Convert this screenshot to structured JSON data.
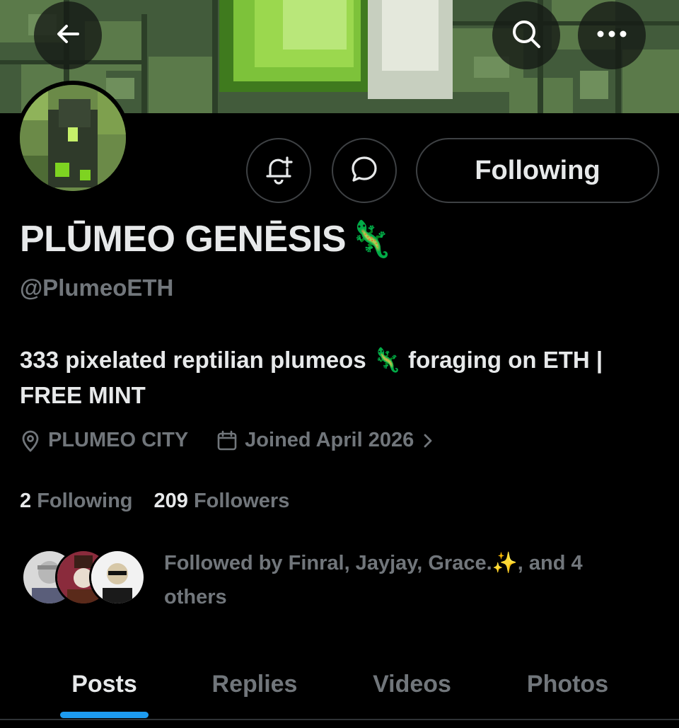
{
  "header": {
    "back_icon": "arrow-left-icon",
    "search_icon": "search-icon",
    "more_icon": "more-horizontal-icon"
  },
  "profile": {
    "name": "PLŪMEO GENĒSIS",
    "name_emoji": "🦎",
    "handle": "@PlumeoETH",
    "bio": "333 pixelated reptilian plumeos 🦎 foraging on ETH | FREE MINT",
    "location": "PLUMEO CITY",
    "joined": "Joined April 2026",
    "following_count": "2",
    "following_label": "Following",
    "followers_count": "209",
    "followers_label": "Followers",
    "followed_by": "Followed by Finral, Jayjay, Grace.✨, and 4 others"
  },
  "actions": {
    "notify_icon": "bell-plus-icon",
    "message_icon": "message-bubble-icon",
    "following_button": "Following"
  },
  "tabs": [
    {
      "label": "Posts",
      "active": true
    },
    {
      "label": "Replies",
      "active": false
    },
    {
      "label": "Videos",
      "active": false
    },
    {
      "label": "Photos",
      "active": false
    }
  ],
  "colors": {
    "accent": "#1d9bf0",
    "muted": "#71767b",
    "text": "#e7e9ea",
    "background": "#000000"
  }
}
